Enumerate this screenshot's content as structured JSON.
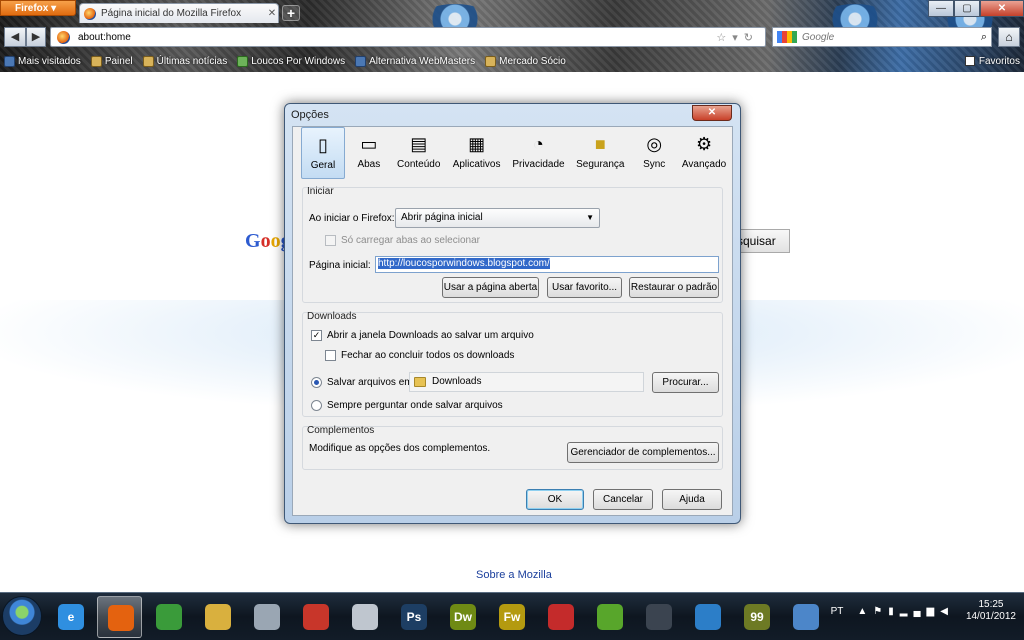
{
  "browser": {
    "menu_button": "Firefox",
    "tab_title": "Página inicial do Mozilla Firefox",
    "new_tab": "+",
    "url": "about:home",
    "search_placeholder": "Google",
    "window_controls": {
      "minimize": "—",
      "maximize": "▢",
      "close": "✕"
    },
    "bookmarks": [
      "Mais visitados",
      "Painel",
      "Últimas notícias",
      "Loucos Por Windows",
      "Alternativa WebMasters",
      "Mercado Sócio"
    ],
    "favorites": "Favoritos"
  },
  "page": {
    "google_partial": "Goog",
    "search_button": "squisar",
    "about_link": "Sobre a Mozilla"
  },
  "dialog": {
    "title": "Opções",
    "close": "✕",
    "panes": [
      {
        "label": "Geral",
        "icon": "general-icon"
      },
      {
        "label": "Abas",
        "icon": "tabs-icon"
      },
      {
        "label": "Conteúdo",
        "icon": "content-icon"
      },
      {
        "label": "Aplicativos",
        "icon": "applications-icon"
      },
      {
        "label": "Privacidade",
        "icon": "privacy-mask-icon"
      },
      {
        "label": "Segurança",
        "icon": "padlock-icon"
      },
      {
        "label": "Sync",
        "icon": "sync-icon"
      },
      {
        "label": "Avançado",
        "icon": "gear-icon"
      }
    ],
    "startup": {
      "group": "Iniciar",
      "when_starts_label": "Ao iniciar o Firefox:",
      "when_starts_value": "Abrir página inicial",
      "load_tabs_label": "Só carregar abas ao selecionar",
      "homepage_label": "Página inicial:",
      "homepage_value": "http://loucosporwindows.blogspot.com/",
      "use_current": "Usar a página aberta",
      "use_bookmark": "Usar favorito...",
      "restore_default": "Restaurar o padrão"
    },
    "downloads": {
      "group": "Downloads",
      "show_window": "Abrir a janela Downloads ao salvar um arquivo",
      "close_when_done": "Fechar ao concluir todos os downloads",
      "save_to_label": "Salvar arquivos em:",
      "save_to_folder": "Downloads",
      "browse": "Procurar...",
      "always_ask": "Sempre perguntar onde salvar arquivos"
    },
    "addons": {
      "group": "Complementos",
      "description": "Modifique as opções dos complementos.",
      "manage": "Gerenciador de complementos..."
    },
    "ok": "OK",
    "cancel": "Cancelar",
    "help": "Ajuda"
  },
  "taskbar": {
    "language": "PT",
    "time": "15:25",
    "date": "14/01/2012",
    "apps": [
      {
        "name": "internet-explorer-icon",
        "glyph": "e",
        "color": "#2f8fe0"
      },
      {
        "name": "firefox-icon",
        "glyph": "",
        "color": "#e4620f",
        "active": true
      },
      {
        "name": "chrome-icon",
        "glyph": "",
        "color": "#3a9b3a"
      },
      {
        "name": "folder-icon",
        "glyph": "",
        "color": "#d9b03e"
      },
      {
        "name": "game-controller-icon",
        "glyph": "",
        "color": "#9aa6b3"
      },
      {
        "name": "ccleaner-icon",
        "glyph": "",
        "color": "#c8362a"
      },
      {
        "name": "app-icon",
        "glyph": "",
        "color": "#bfc6cf"
      },
      {
        "name": "photoshop-icon",
        "glyph": "Ps",
        "color": "#1d3e63"
      },
      {
        "name": "dreamweaver-icon",
        "glyph": "Dw",
        "color": "#6f8a14"
      },
      {
        "name": "fireworks-icon",
        "glyph": "Fw",
        "color": "#b49a10"
      },
      {
        "name": "media-icon",
        "glyph": "",
        "color": "#c42b2b"
      },
      {
        "name": "utorrent-icon",
        "glyph": "",
        "color": "#58a62b"
      },
      {
        "name": "camera-icon",
        "glyph": "",
        "color": "#3b4450"
      },
      {
        "name": "alienware-icon",
        "glyph": "",
        "color": "#2c7ec8"
      },
      {
        "name": "counter-icon",
        "glyph": "99",
        "color": "#6d7a24"
      },
      {
        "name": "network-icon",
        "glyph": "",
        "color": "#4c86c9"
      }
    ]
  }
}
